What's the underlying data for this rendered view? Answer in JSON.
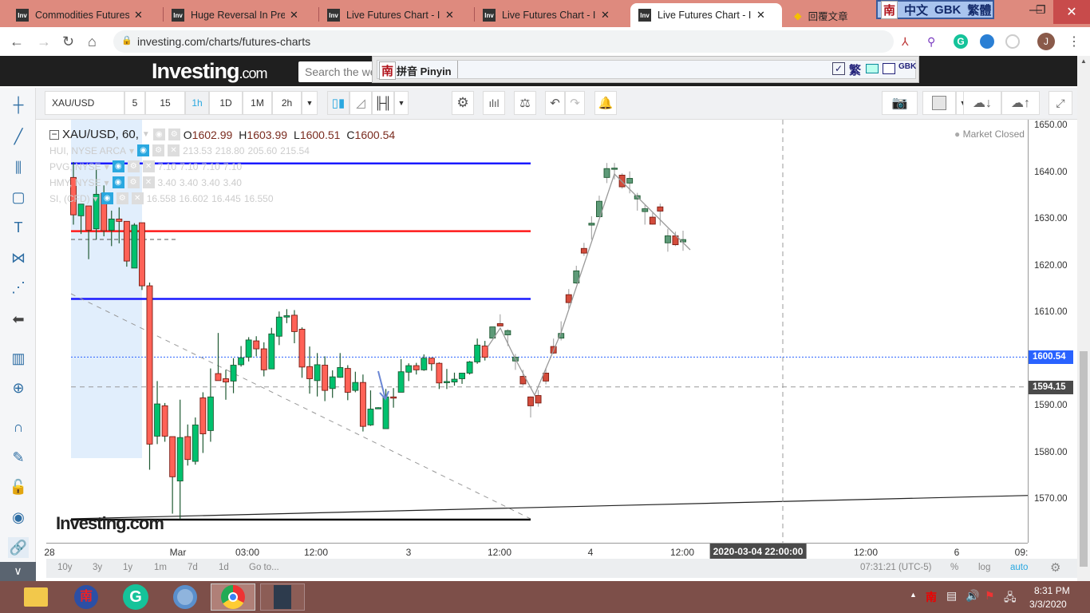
{
  "browser": {
    "tabs": [
      {
        "title": "Commodities Futures Pri",
        "icon": "investing-favicon"
      },
      {
        "title": "Huge Reversal In Preciou",
        "icon": "investing-favicon"
      },
      {
        "title": "Live Futures Chart - Inves",
        "icon": "investing-favicon"
      },
      {
        "title": "Live Futures Chart - Inves",
        "icon": "investing-favicon"
      },
      {
        "title": "Live Futures Chart - Inves",
        "icon": "investing-favicon",
        "active": true
      },
      {
        "title": "回覆文章",
        "icon": "gem-favicon"
      }
    ],
    "url": "investing.com/charts/futures-charts",
    "profile_initial": "J",
    "ime_status": [
      "中文",
      "GBK",
      "繁體"
    ],
    "ime_bar_label": "拼音 Pinyin",
    "ime_nan": "南",
    "ime_trad": "繁",
    "ime_gbk": "GBK"
  },
  "site": {
    "logo": "Investing",
    "logo_suffix": ".com",
    "search_placeholder": "Search the website..."
  },
  "toolbar": {
    "symbol": "XAU/USD",
    "intervals": [
      "5",
      "15",
      "1h",
      "1D",
      "1M",
      "2h"
    ],
    "active_interval": "1h"
  },
  "legend": {
    "main": {
      "title": "XAU/USD, 60,",
      "o_label": "O",
      "o": "1602.99",
      "h_label": "H",
      "h": "1603.99",
      "l_label": "L",
      "l": "1600.51",
      "c_label": "C",
      "c": "1600.54"
    },
    "overlays": [
      {
        "name": "HUI, NYSE ARCA",
        "values": [
          "213.53",
          "218.80",
          "205.60",
          "215.54"
        ]
      },
      {
        "name": "PVG, NYSE",
        "values": [
          "7.10",
          "7.10",
          "7.10",
          "7.10"
        ]
      },
      {
        "name": "HMY, NYSE",
        "values": [
          "3.40",
          "3.40",
          "3.40",
          "3.40"
        ]
      },
      {
        "name": "SI, (CFD)",
        "values": [
          "16.558",
          "16.602",
          "16.445",
          "16.550"
        ]
      }
    ],
    "market_status": "Market Closed",
    "watermark": "Investing.com"
  },
  "chart_data": {
    "type": "candlestick",
    "ylim": [
      1562,
      1652
    ],
    "y_ticks": [
      "1650.00",
      "1640.00",
      "1630.00",
      "1620.00",
      "1610.00",
      "1600.00",
      "1590.00",
      "1580.00",
      "1570.00"
    ],
    "last_price_label": "1600.54",
    "crosshair_price_label": "1594.15",
    "crosshair_time_label": "2020-03-04 22:00:00",
    "x_ticks": [
      "28",
      "Mar",
      "03:00",
      "12:00",
      "3",
      "12:00",
      "4",
      "12:00",
      "12:00",
      "6",
      "09:"
    ],
    "colors": {
      "up": "#00c16e",
      "down": "#ff6257",
      "up_muted": "#5e9a78",
      "down_muted": "#d34c3c",
      "last_price": "#2962ff"
    },
    "candles": [
      [
        1639.0,
        1642.3,
        1628.9,
        1631.0
      ],
      [
        1630.8,
        1633.3,
        1626.9,
        1633.3
      ],
      [
        1632.9,
        1632.9,
        1621.5,
        1627.7
      ],
      [
        1628.0,
        1640.8,
        1625.7,
        1635.4
      ],
      [
        1635.6,
        1637.3,
        1626.4,
        1627.6
      ],
      [
        1627.7,
        1631.9,
        1624.3,
        1630.1
      ],
      [
        1630.1,
        1632.6,
        1624.9,
        1629.6
      ],
      [
        1629.6,
        1629.6,
        1619.9,
        1621.1
      ],
      [
        1619.6,
        1629.2,
        1619.6,
        1628.8
      ],
      [
        1629.3,
        1629.3,
        1614.9,
        1615.8
      ],
      [
        1615.8,
        1616.5,
        1576.4,
        1581.9
      ],
      [
        1583.6,
        1595.4,
        1581.9,
        1590.5
      ],
      [
        1590.1,
        1590.7,
        1582.4,
        1583.6
      ],
      [
        1583.5,
        1583.5,
        1567.0,
        1574.9
      ],
      [
        1574.0,
        1591.4,
        1565.9,
        1583.3
      ],
      [
        1583.5,
        1586.1,
        1577.3,
        1578.6
      ],
      [
        1578.2,
        1587.6,
        1577.5,
        1586.0
      ],
      [
        1591.8,
        1593.0,
        1580.0,
        1584.1
      ],
      [
        1584.8,
        1598.1,
        1582.4,
        1592.0
      ],
      [
        1597.0,
        1605.7,
        1595.5,
        1595.5
      ],
      [
        1595.9,
        1597.8,
        1591.4,
        1595.2
      ],
      [
        1595.4,
        1600.3,
        1592.8,
        1598.8
      ],
      [
        1598.9,
        1602.9,
        1598.5,
        1600.4
      ],
      [
        1600.5,
        1604.8,
        1599.6,
        1604.2
      ],
      [
        1604.0,
        1605.0,
        1600.7,
        1602.3
      ],
      [
        1602.3,
        1603.7,
        1596.4,
        1597.8
      ],
      [
        1598.0,
        1606.8,
        1598.0,
        1605.5
      ],
      [
        1605.0,
        1610.3,
        1603.1,
        1609.1
      ],
      [
        1609.1,
        1610.8,
        1607.8,
        1609.4
      ],
      [
        1609.5,
        1610.6,
        1603.5,
        1606.0
      ],
      [
        1606.5,
        1606.9,
        1596.1,
        1598.4
      ],
      [
        1598.5,
        1602.8,
        1592.7,
        1595.9
      ],
      [
        1595.5,
        1601.4,
        1592.1,
        1598.9
      ],
      [
        1598.8,
        1600.7,
        1591.1,
        1593.4
      ],
      [
        1593.8,
        1597.7,
        1591.8,
        1596.3
      ],
      [
        1596.2,
        1601.4,
        1596.1,
        1598.3
      ],
      [
        1598.1,
        1598.8,
        1591.3,
        1593.0
      ],
      [
        1593.4,
        1597.4,
        1593.0,
        1595.1
      ],
      [
        1595.1,
        1596.8,
        1584.6,
        1585.7
      ],
      [
        1586.0,
        1593.4,
        1585.8,
        1589.4
      ],
      [
        1589.6,
        1589.8,
        1589.4,
        1589.7
      ],
      [
        1585.2,
        1593.7,
        1585.2,
        1592.0
      ],
      [
        1592.0,
        1593.9,
        1589.7,
        1591.9
      ],
      [
        1593.0,
        1600.1,
        1593.0,
        1597.4
      ],
      [
        1597.3,
        1599.2,
        1595.4,
        1598.7
      ],
      [
        1598.7,
        1599.3,
        1596.8,
        1597.8
      ],
      [
        1597.8,
        1601.1,
        1597.6,
        1600.3
      ],
      [
        1600.3,
        1600.4,
        1597.6,
        1599.1
      ],
      [
        1599.2,
        1599.4,
        1593.7,
        1595.0
      ],
      [
        1595.1,
        1598.0,
        1593.7,
        1595.3
      ],
      [
        1595.2,
        1597.2,
        1594.4,
        1595.8
      ],
      [
        1595.9,
        1597.1,
        1594.8,
        1597.1
      ],
      [
        1597.1,
        1599.7,
        1596.8,
        1599.5
      ],
      [
        1599.5,
        1604.5,
        1599.1,
        1603.1
      ],
      [
        1602.9,
        1604.0,
        1599.8,
        1600.5
      ],
      [
        1604.6,
        1607.0,
        1604.6,
        1607.0
      ],
      [
        1607.7,
        1609.7,
        1607.2,
        1607.2
      ],
      [
        1605.3,
        1606.5,
        1602.9,
        1606.2
      ],
      [
        1599.7,
        1601.2,
        1597.8,
        1600.5
      ],
      [
        1596.4,
        1597.8,
        1594.4,
        1594.8
      ],
      [
        1592.0,
        1592.1,
        1587.6,
        1590.1
      ],
      [
        1592.3,
        1593.5,
        1589.9,
        1590.7
      ],
      [
        1597.1,
        1598.2,
        1594.7,
        1595.4
      ],
      [
        1602.8,
        1604.5,
        1601.2,
        1601.4
      ],
      [
        1604.6,
        1608.2,
        1604.1,
        1605.6
      ],
      [
        1613.9,
        1615.1,
        1610.9,
        1612.2
      ],
      [
        1616.4,
        1620.1,
        1616.2,
        1619.0
      ],
      [
        1623.8,
        1625.0,
        1622.2,
        1622.8
      ],
      [
        1628.8,
        1630.7,
        1625.7,
        1629.2
      ],
      [
        1630.6,
        1635.1,
        1630.6,
        1633.9
      ],
      [
        1639.0,
        1642.1,
        1637.8,
        1640.9
      ],
      [
        1641.0,
        1642.1,
        1638.6,
        1641.0
      ],
      [
        1639.5,
        1639.9,
        1636.6,
        1637.0
      ],
      [
        1637.8,
        1640.3,
        1635.6,
        1638.8
      ],
      [
        1634.4,
        1635.7,
        1631.9,
        1635.1
      ],
      [
        1631.7,
        1633.1,
        1628.9,
        1632.3
      ],
      [
        1630.5,
        1631.4,
        1628.9,
        1629.0
      ],
      [
        1632.7,
        1633.4,
        1628.7,
        1631.8
      ],
      [
        1625.0,
        1628.0,
        1623.1,
        1626.5
      ],
      [
        1626.5,
        1627.4,
        1624.3,
        1624.6
      ],
      [
        1625.2,
        1627.6,
        1623.3,
        1625.7
      ]
    ],
    "horizontal_lines": [
      {
        "price": 1642.0,
        "color": "#1a1aff"
      },
      {
        "price": 1627.5,
        "color": "#ff1a1a"
      },
      {
        "price": 1613.0,
        "color": "#1a1aff"
      }
    ]
  },
  "bottom": {
    "ranges": [
      "10y",
      "3y",
      "1y",
      "1m",
      "7d",
      "1d",
      "Go to..."
    ],
    "clock": "07:31:21 (UTC-5)",
    "percent": "%",
    "log": "log",
    "auto": "auto"
  },
  "taskbar": {
    "time": "8:31 PM",
    "date": "3/3/2020"
  }
}
